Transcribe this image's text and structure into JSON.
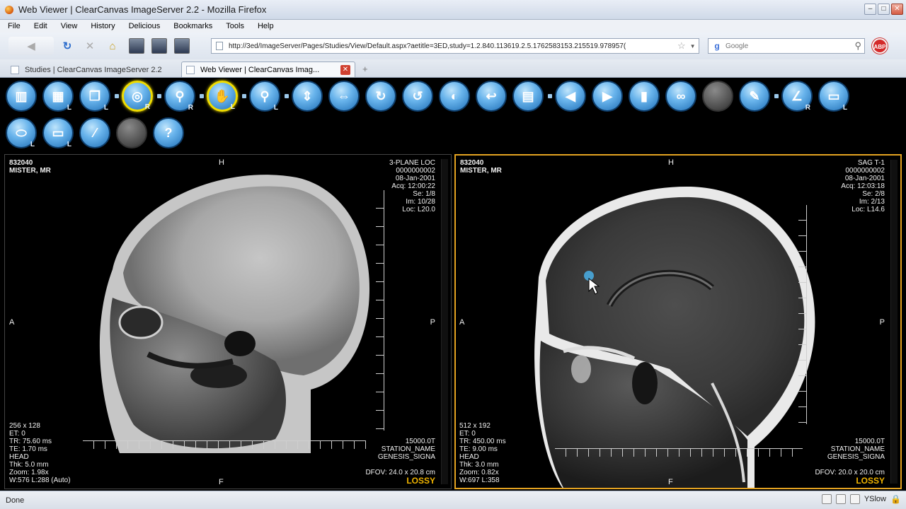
{
  "window": {
    "title": "Web Viewer | ClearCanvas ImageServer 2.2 - Mozilla Firefox"
  },
  "menu": [
    "File",
    "Edit",
    "View",
    "History",
    "Delicious",
    "Bookmarks",
    "Tools",
    "Help"
  ],
  "nav": {
    "url": "http://3ed/ImageServer/Pages/Studies/View/Default.aspx?aetitle=3ED,study=1.2.840.113619.2.5.1762583153.215519.978957(",
    "search_placeholder": "Google"
  },
  "tabs": [
    {
      "label": "Studies | ClearCanvas ImageServer 2.2"
    },
    {
      "label": "Web Viewer | ClearCanvas Imag..."
    }
  ],
  "toolbar": {
    "row1": [
      {
        "icon": "layout-icon",
        "glyph": "▥",
        "sub": ""
      },
      {
        "icon": "series-icon",
        "glyph": "▦",
        "sub": "L"
      },
      {
        "icon": "stack-icon",
        "glyph": "❐",
        "sub": "L"
      },
      {
        "icon": "zoom-window-icon",
        "glyph": "◎",
        "sub": "R"
      },
      {
        "icon": "magnify-icon",
        "glyph": "⚲",
        "sub": "R"
      },
      {
        "icon": "pan-hand-icon",
        "glyph": "✋",
        "sub": "L"
      },
      {
        "icon": "probe-icon",
        "glyph": "⚲",
        "sub": "L"
      },
      {
        "icon": "flip-vertical-icon",
        "glyph": "⇕",
        "sub": ""
      },
      {
        "icon": "flip-horizontal-icon",
        "glyph": "⇔",
        "sub": ""
      },
      {
        "icon": "rotate-right-icon",
        "glyph": "↻",
        "sub": ""
      },
      {
        "icon": "rotate-left-icon",
        "glyph": "↺",
        "sub": ""
      },
      {
        "icon": "invert-icon",
        "glyph": "◐",
        "sub": ""
      },
      {
        "icon": "reset-icon",
        "glyph": "↩",
        "sub": ""
      },
      {
        "icon": "presets-icon",
        "glyph": "▤",
        "sub": ""
      },
      {
        "icon": "previous-icon",
        "glyph": "◀",
        "sub": ""
      },
      {
        "icon": "next-icon",
        "glyph": "▶",
        "sub": ""
      },
      {
        "icon": "cine-icon",
        "glyph": "▮",
        "sub": ""
      },
      {
        "icon": "link-icon",
        "glyph": "∞",
        "sub": ""
      },
      {
        "icon": "disabled-tool-icon",
        "glyph": "",
        "sub": ""
      },
      {
        "icon": "annotation-icon",
        "glyph": "✎",
        "sub": ""
      },
      {
        "icon": "angle-icon",
        "glyph": "∠",
        "sub": "R"
      },
      {
        "icon": "ruler-icon",
        "glyph": "▭",
        "sub": "L"
      }
    ],
    "row2": [
      {
        "icon": "roi-ellipse-icon",
        "glyph": "⬭",
        "sub": "L"
      },
      {
        "icon": "roi-rect-icon",
        "glyph": "▭",
        "sub": "L"
      },
      {
        "icon": "calibrate-icon",
        "glyph": "⁄",
        "sub": ""
      },
      {
        "icon": "disabled-tool-2-icon",
        "glyph": "",
        "sub": ""
      },
      {
        "icon": "help-icon",
        "glyph": "?",
        "sub": ""
      }
    ]
  },
  "viewports": [
    {
      "patient_id": "832040",
      "patient_name": "MISTER, MR",
      "series_desc": "3-PLANE LOC",
      "accession": "0000000002",
      "date": "08-Jan-2001",
      "acq": "Acq: 12:00:22",
      "se": "Se: 1/8",
      "im": "Im: 10/28",
      "loc": "Loc: L20.0",
      "orient_top": "H",
      "orient_left": "A",
      "orient_right": "P",
      "orient_bottom": "F",
      "matrix": "256 x 128",
      "et": "ET: 0",
      "tr": "TR: 75.60 ms",
      "te": "TE: 1.70 ms",
      "anatomy": "HEAD",
      "thk": "Thk: 5.0 mm",
      "zoom": "Zoom: 1.98x",
      "wl": "W:576 L:288 (Auto)",
      "field": "15000.0T",
      "station": "STATION_NAME",
      "model": "GENESIS_SIGNA",
      "dfov": "DFOV: 24.0 x 20.8 cm",
      "compression": "LOSSY"
    },
    {
      "patient_id": "832040",
      "patient_name": "MISTER, MR",
      "series_desc": "SAG T-1",
      "accession": "0000000002",
      "date": "08-Jan-2001",
      "acq": "Acq: 12:03:18",
      "se": "Se: 2/8",
      "im": "Im: 2/13",
      "loc": "Loc: L14.6",
      "orient_top": "H",
      "orient_left": "A",
      "orient_right": "P",
      "orient_bottom": "F",
      "matrix": "512 x 192",
      "et": "ET: 0",
      "tr": "TR: 450.00 ms",
      "te": "TE: 9.00 ms",
      "anatomy": "HEAD",
      "thk": "Thk: 3.0 mm",
      "zoom": "Zoom: 0.82x",
      "wl": "W:697 L:358",
      "field": "15000.0T",
      "station": "STATION_NAME",
      "model": "GENESIS_SIGNA",
      "dfov": "DFOV: 20.0 x 20.0 cm",
      "compression": "LOSSY"
    }
  ],
  "status": {
    "text": "Done",
    "yslow": "YSlow"
  },
  "colors": {
    "active_viewport_border": "#e4a321",
    "selected_tool_ring": "#f0dc00",
    "lossy_text": "#f0b400",
    "tool_blue": "#3d8fd4"
  }
}
